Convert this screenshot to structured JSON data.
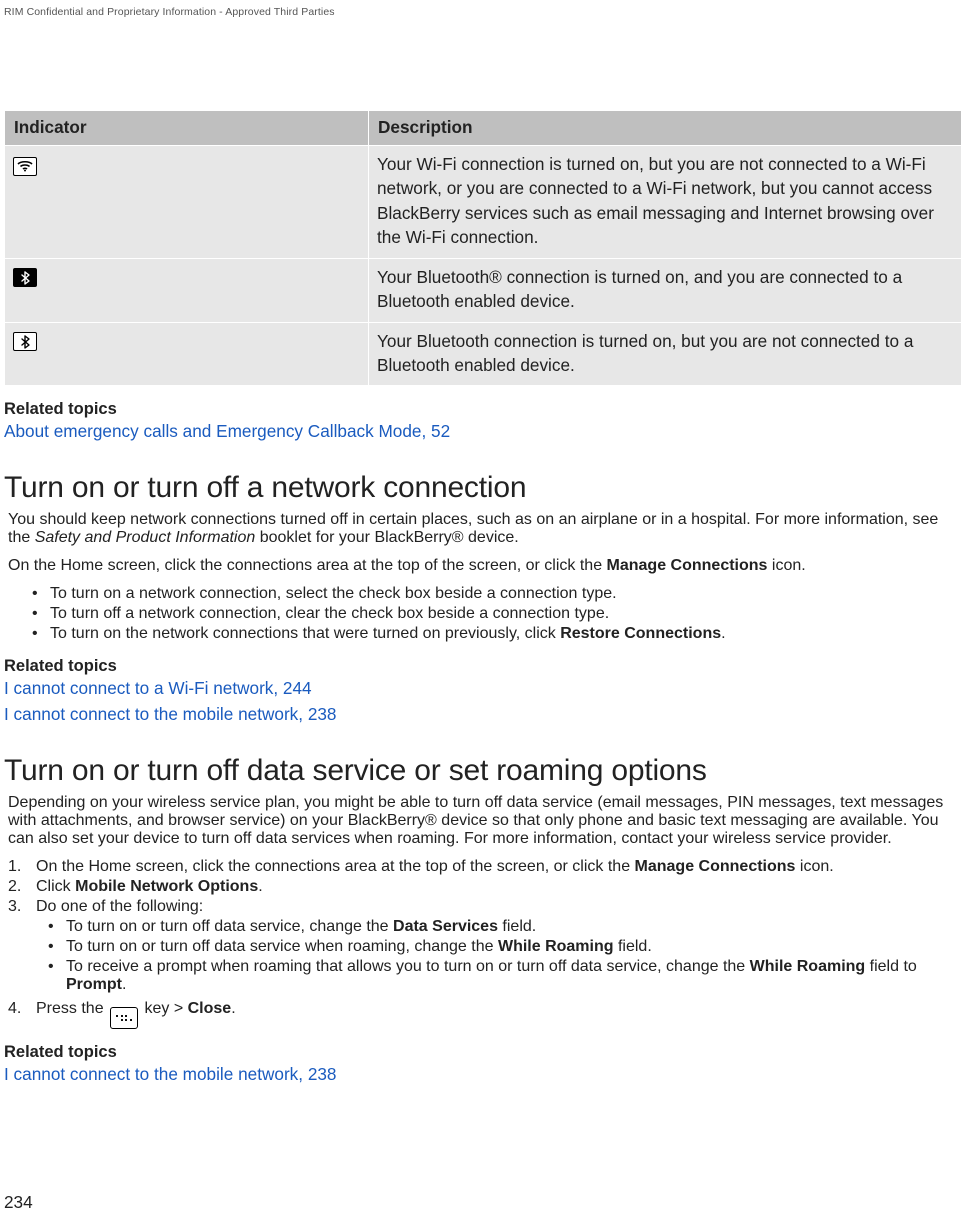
{
  "header": {
    "confidential": "RIM Confidential and Proprietary Information - Approved Third Parties"
  },
  "table": {
    "headers": {
      "indicator": "Indicator",
      "description": "Description"
    },
    "rows": [
      {
        "icon": "wifi-disconnected-icon",
        "description": "Your Wi-Fi connection is turned on, but you are not connected to a Wi-Fi network, or you are connected to a Wi-Fi network, but you cannot access BlackBerry services such as email messaging and Internet browsing over the Wi-Fi connection."
      },
      {
        "icon": "bluetooth-connected-icon",
        "description": "Your Bluetooth® connection is turned on, and you are connected to a Bluetooth enabled device."
      },
      {
        "icon": "bluetooth-disconnected-icon",
        "description": "Your Bluetooth connection is turned on, but you are not connected to a Bluetooth enabled device."
      }
    ]
  },
  "related1": {
    "heading": "Related topics",
    "links": [
      {
        "text": "About emergency calls and Emergency Callback Mode, 52"
      }
    ]
  },
  "section_network": {
    "heading": "Turn on or turn off a network connection",
    "intro_part1": "You should keep network connections turned off in certain places, such as on an airplane or in a hospital. For more information, see the ",
    "intro_italic": "Safety and Product Information",
    "intro_part2": " booklet for your BlackBerry® device.",
    "instruction_pre": "On the Home screen, click the connections area at the top of the screen, or click the ",
    "instruction_bold": "Manage Connections",
    "instruction_post": " icon.",
    "bullets": [
      "To turn on a network connection, select the check box beside a connection type.",
      "To turn off a network connection, clear the check box beside a connection type."
    ],
    "bullet3_pre": "To turn on the network connections that were turned on previously, click ",
    "bullet3_bold": "Restore Connections",
    "bullet3_post": "."
  },
  "related2": {
    "heading": "Related topics",
    "links": [
      {
        "text": "I cannot connect to a Wi-Fi network, 244"
      },
      {
        "text": "I cannot connect to the mobile network, 238"
      }
    ]
  },
  "section_data": {
    "heading": "Turn on or turn off data service or set roaming options",
    "intro": "Depending on your wireless service plan, you might be able to turn off data service (email messages, PIN messages, text messages with attachments, and browser service) on your BlackBerry® device so that only phone and basic text messaging are available. You can also set your device to turn off data services when roaming. For more information, contact your wireless service provider.",
    "step1_pre": "On the Home screen, click the connections area at the top of the screen, or click the ",
    "step1_bold": "Manage Connections",
    "step1_post": " icon.",
    "step2_pre": "Click ",
    "step2_bold": "Mobile Network Options",
    "step2_post": ".",
    "step3_text": "Do one of the following:",
    "step3_bullets": {
      "b1_pre": "To turn on or turn off data service, change the ",
      "b1_bold": "Data Services",
      "b1_post": " field.",
      "b2_pre": "To turn on or turn off data service when roaming, change the ",
      "b2_bold": "While Roaming",
      "b2_post": " field.",
      "b3_pre": "To receive a prompt when roaming that allows you to turn on or turn off data service, change the ",
      "b3_bold1": "While Roaming",
      "b3_mid": " field to ",
      "b3_bold2": "Prompt",
      "b3_post": "."
    },
    "step4_pre": "Press the ",
    "step4_mid": " key > ",
    "step4_bold": "Close",
    "step4_post": "."
  },
  "related3": {
    "heading": "Related topics",
    "links": [
      {
        "text": "I cannot connect to the mobile network, 238"
      }
    ]
  },
  "page_number": "234"
}
